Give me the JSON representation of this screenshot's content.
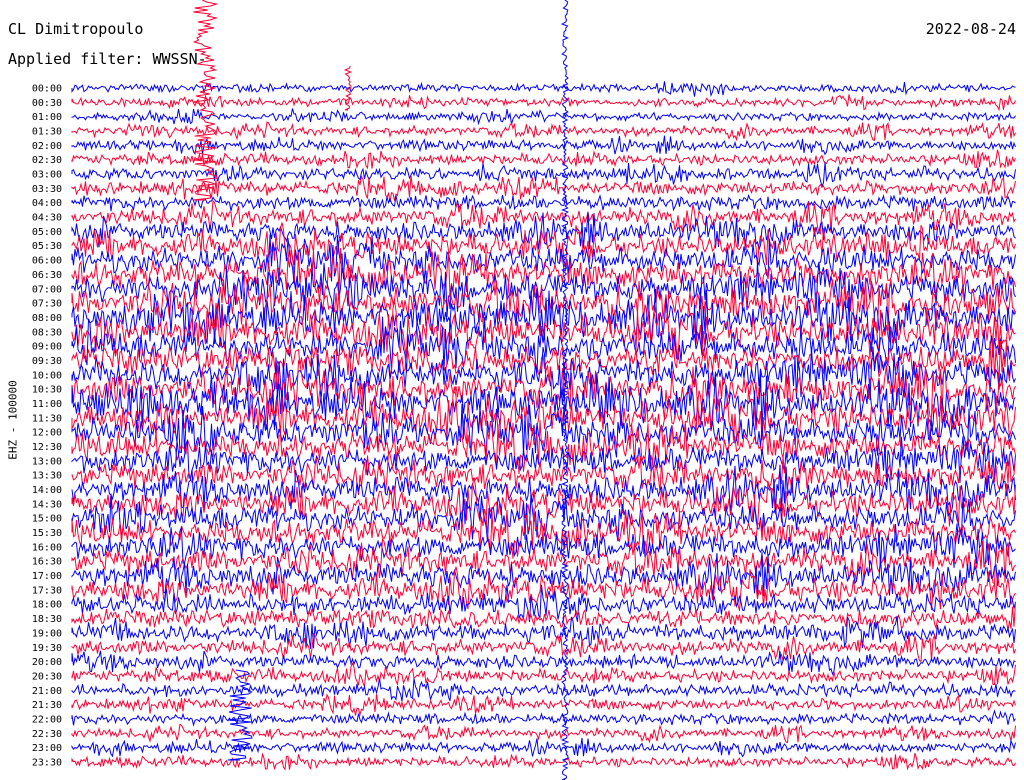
{
  "header": {
    "station": "CL Dimitropoulo",
    "date": "2022-08-24",
    "filter": "Applied filter: WWSSN-"
  },
  "side_label": "EHZ - 100000",
  "colors": {
    "trace_a": "#0000ff",
    "trace_b": "#ff0033",
    "background": "#ffffff",
    "text": "#000000"
  },
  "chart_data": {
    "type": "line",
    "hour_labels": [
      "00:00",
      "00:30",
      "01:00",
      "01:30",
      "02:00",
      "02:30",
      "03:00",
      "03:30",
      "04:00",
      "04:30",
      "05:00",
      "05:30",
      "06:00",
      "06:30",
      "07:00",
      "07:30",
      "08:00",
      "08:30",
      "09:00",
      "09:30",
      "10:00",
      "10:30",
      "11:00",
      "11:30",
      "12:00",
      "12:30",
      "13:00",
      "13:30",
      "14:00",
      "14:30",
      "15:00",
      "15:30",
      "16:00",
      "16:30",
      "17:00",
      "17:30",
      "18:00",
      "18:30",
      "19:00",
      "19:30",
      "20:00",
      "20:30",
      "21:00",
      "21:30",
      "22:00",
      "22:30",
      "23:00",
      "23:30"
    ],
    "color_sequence": [
      "blue",
      "red"
    ],
    "noise_level": [
      0.15,
      0.15,
      0.15,
      0.2,
      0.2,
      0.25,
      0.3,
      0.35,
      0.4,
      0.5,
      0.6,
      0.7,
      0.85,
      0.9,
      0.95,
      1.0,
      1.0,
      1.0,
      1.0,
      1.0,
      1.0,
      1.0,
      1.0,
      1.0,
      0.95,
      0.9,
      0.85,
      0.8,
      0.8,
      0.8,
      0.85,
      0.85,
      0.8,
      0.75,
      0.75,
      0.7,
      0.6,
      0.55,
      0.5,
      0.4,
      0.35,
      0.3,
      0.3,
      0.25,
      0.25,
      0.2,
      0.2,
      0.2
    ]
  }
}
